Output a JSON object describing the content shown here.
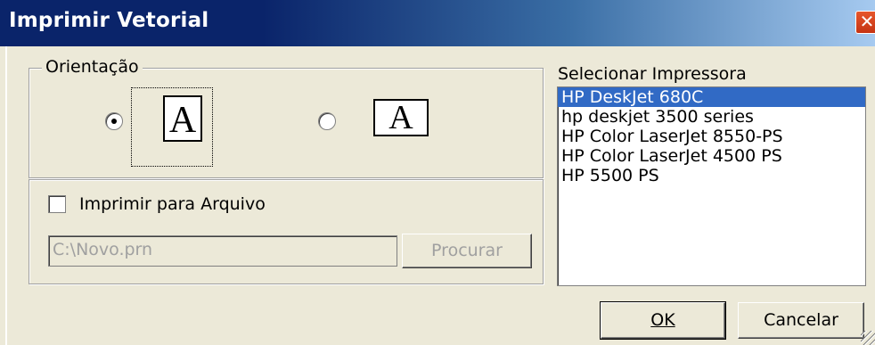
{
  "window": {
    "title": "Imprimir Vetorial",
    "close_glyph": "✕"
  },
  "orientation": {
    "legend": "Orientação",
    "portrait": {
      "selected": true,
      "icon": "portrait-page-icon",
      "letter": "A"
    },
    "landscape": {
      "selected": false,
      "icon": "landscape-page-icon",
      "letter": "A"
    }
  },
  "print_to_file": {
    "checkbox_label": "Imprimir para Arquivo",
    "checked": false,
    "file_path": "C:\\Novo.prn",
    "browse_label": "Procurar"
  },
  "printers": {
    "label": "Selecionar Impressora",
    "items": [
      {
        "label": "HP DeskJet 680C",
        "selected": true
      },
      {
        "label": "hp deskjet 3500 series",
        "selected": false
      },
      {
        "label": "HP Color LaserJet 8550-PS",
        "selected": false
      },
      {
        "label": "HP Color LaserJet 4500 PS",
        "selected": false
      },
      {
        "label": "HP 5500 PS",
        "selected": false
      }
    ]
  },
  "buttons": {
    "ok": "OK",
    "cancel": "Cancelar"
  },
  "colors": {
    "titlebar": "#0a246a",
    "selection": "#316ac5",
    "face": "#ece9d8"
  }
}
